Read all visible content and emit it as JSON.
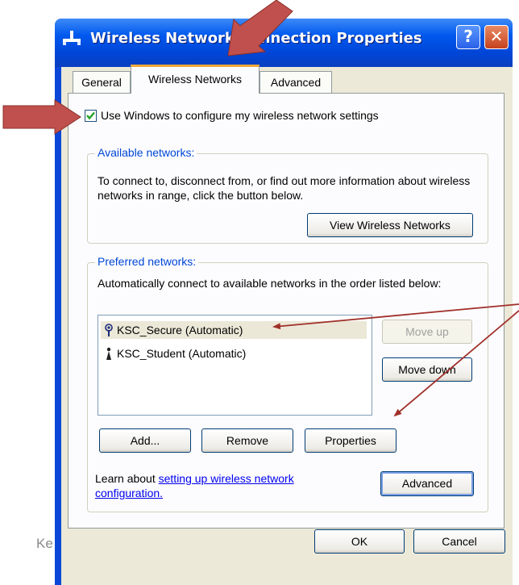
{
  "window": {
    "title": "Wireless Network Connection Properties",
    "help_glyph": "?",
    "close_glyph": "✕"
  },
  "tabs": [
    {
      "label": "General",
      "active": false
    },
    {
      "label": "Wireless Networks",
      "active": true
    },
    {
      "label": "Advanced",
      "active": false
    }
  ],
  "use_windows_checkbox": {
    "label": "Use Windows to configure my wireless network settings",
    "checked": true
  },
  "available_networks": {
    "heading": "Available networks:",
    "description": "To connect to, disconnect from, or find out more information about wireless networks in range, click the button below.",
    "view_button": "View Wireless Networks"
  },
  "preferred_networks": {
    "heading": "Preferred networks:",
    "description": "Automatically connect to available networks in the order listed below:",
    "items": [
      {
        "label": "KSC_Secure (Automatic)",
        "icon": "wireless-secure-icon",
        "selected": true
      },
      {
        "label": "KSC_Student (Automatic)",
        "icon": "wireless-antenna-icon",
        "selected": false
      }
    ],
    "move_up": "Move up",
    "move_down": "Move down",
    "add": "Add...",
    "remove": "Remove",
    "properties": "Properties"
  },
  "learn": {
    "prefix": "Learn about ",
    "link": "setting up wireless network configuration."
  },
  "advanced_button": "Advanced",
  "ok_button": "OK",
  "cancel_button": "Cancel",
  "watermark_text": "Ke",
  "colors": {
    "titlebar": "#0058ee",
    "group_label": "#0046d5",
    "annotation_arrow": "#c0504d",
    "pointer_line": "#a0302a"
  }
}
